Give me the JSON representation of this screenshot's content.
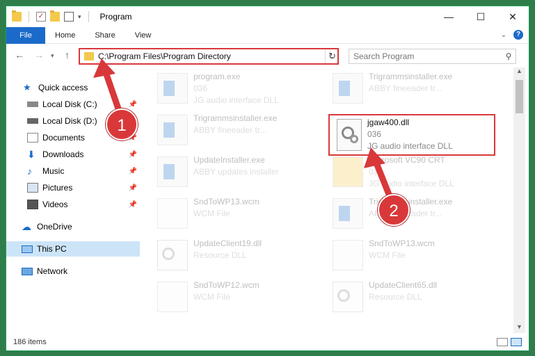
{
  "window": {
    "title": "Program",
    "controls": {
      "minimize": "—",
      "maximize": "☐",
      "close": "✕"
    }
  },
  "ribbon": {
    "tabs": [
      {
        "label": "File"
      },
      {
        "label": "Home"
      },
      {
        "label": "Share"
      },
      {
        "label": "View"
      }
    ],
    "help_label": "?"
  },
  "address": {
    "path": "C:\\Program Files\\Program Directory",
    "search_placeholder": "Search Program"
  },
  "sidebar": {
    "items": [
      {
        "label": "Quick access",
        "icon": "star-icon"
      },
      {
        "label": "Local Disk (C:)",
        "icon": "drive-icon",
        "pinned": true
      },
      {
        "label": "Local Disk (D:)",
        "icon": "drive-icon",
        "pinned": true
      },
      {
        "label": "Documents",
        "icon": "documents-icon",
        "pinned": true
      },
      {
        "label": "Downloads",
        "icon": "download-icon",
        "pinned": true
      },
      {
        "label": "Music",
        "icon": "music-icon",
        "pinned": true
      },
      {
        "label": "Pictures",
        "icon": "pictures-icon",
        "pinned": true
      },
      {
        "label": "Videos",
        "icon": "videos-icon",
        "pinned": true
      },
      {
        "label": "OneDrive",
        "icon": "cloud-icon"
      },
      {
        "label": "This PC",
        "icon": "computer-icon",
        "selected": true
      },
      {
        "label": "Network",
        "icon": "network-icon"
      }
    ]
  },
  "files": [
    {
      "name": "program.exe",
      "l2": "036",
      "l3": "JG audio interface DLL",
      "kind": "exe",
      "faded": true
    },
    {
      "name": "Trigrammsinstaller.exe",
      "l2": "ABBY fineeader tr...",
      "l3": "",
      "kind": "exe",
      "faded": true
    },
    {
      "name": "Trigrammsinstaller.exe",
      "l2": "ABBY fineeader tr...",
      "l3": "",
      "kind": "exe",
      "faded": true
    },
    {
      "name": "jgaw400.dll",
      "l2": "036",
      "l3": "JG audio interface DLL",
      "kind": "dll",
      "faded": false
    },
    {
      "name": "UpdateInstaller.exe",
      "l2": "ABBY updates installer",
      "l3": "",
      "kind": "exe",
      "faded": true
    },
    {
      "name": "Microsoft VC90 CRT",
      "l2": "036",
      "l3": "JG audio interface DLL",
      "kind": "doc",
      "faded": true
    },
    {
      "name": "SndToWP13.wcm",
      "l2": "WCM File",
      "l3": "",
      "kind": "doc",
      "faded": true
    },
    {
      "name": "Trigrammsinstaller.exe",
      "l2": "ABBY fineeader tr...",
      "l3": "",
      "kind": "exe",
      "faded": true
    },
    {
      "name": "UpdateClient19.dll",
      "l2": "Resource DLL",
      "l3": "",
      "kind": "dll",
      "faded": true
    },
    {
      "name": "SndToWP13.wcm",
      "l2": "WCM File",
      "l3": "",
      "kind": "doc",
      "faded": true
    },
    {
      "name": "SndToWP12.wcm",
      "l2": "WCM File",
      "l3": "",
      "kind": "doc",
      "faded": true
    },
    {
      "name": "UpdateClient65.dll",
      "l2": "Resource DLL",
      "l3": "",
      "kind": "dll",
      "faded": true
    }
  ],
  "status": {
    "item_count": "186 items"
  },
  "annotations": {
    "step1": "1",
    "step2": "2",
    "accent": "#d9383a"
  }
}
